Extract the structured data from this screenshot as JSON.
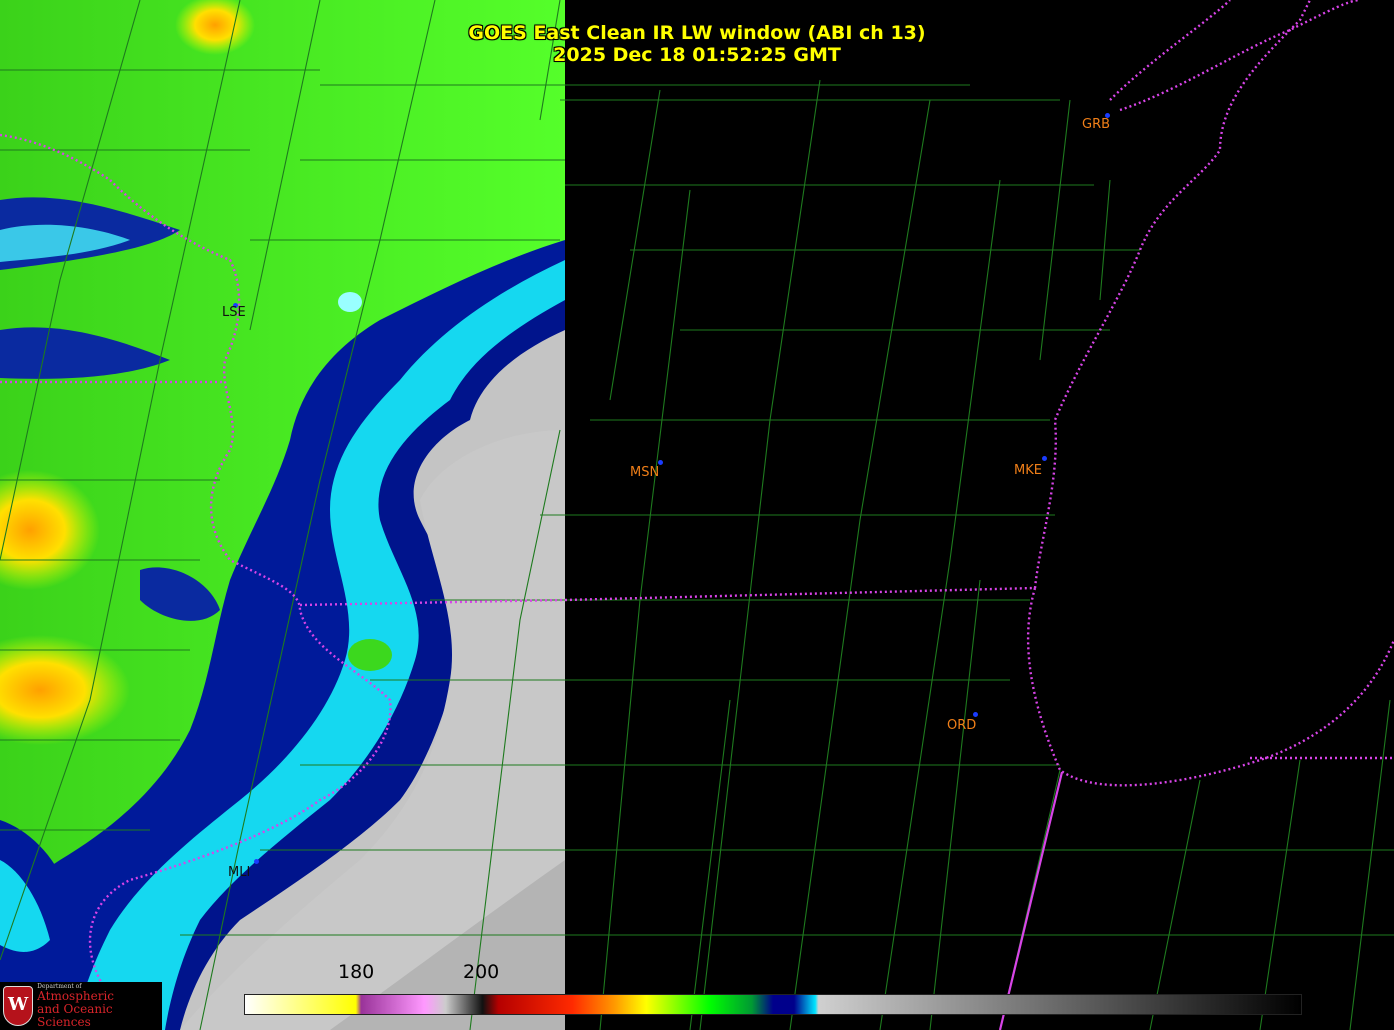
{
  "title": {
    "line1": "GOES East Clean IR LW window (ABI ch 13)",
    "line2": "2025 Dec 18  01:52:25 GMT"
  },
  "stations": [
    {
      "id": "lse",
      "label": "LSE"
    },
    {
      "id": "msn",
      "label": "MSN"
    },
    {
      "id": "mke",
      "label": "MKE"
    },
    {
      "id": "grb",
      "label": "GRB"
    },
    {
      "id": "ord",
      "label": "ORD"
    },
    {
      "id": "mli",
      "label": "MLI"
    }
  ],
  "colorbar": {
    "tick_labels": [
      "180",
      "200"
    ],
    "colors": [
      "#ffffff",
      "#ffff00",
      "#ff99ff",
      "#993399",
      "#cccccc",
      "#111111",
      "#b50000",
      "#ff2a00",
      "#ff9900",
      "#ffff00",
      "#00ff00",
      "#009933",
      "#00008b",
      "#00e5ff",
      "#d0d0d0",
      "#000000"
    ]
  },
  "logo": {
    "letter": "W",
    "dept": "Department of",
    "line1": "Atmospheric",
    "line2": "and Oceanic Sciences"
  },
  "colors": {
    "title": "#ffff00",
    "station_label": "#f07f18",
    "county_lines": "#1e7a1e",
    "state_borders": "#d844e8"
  }
}
